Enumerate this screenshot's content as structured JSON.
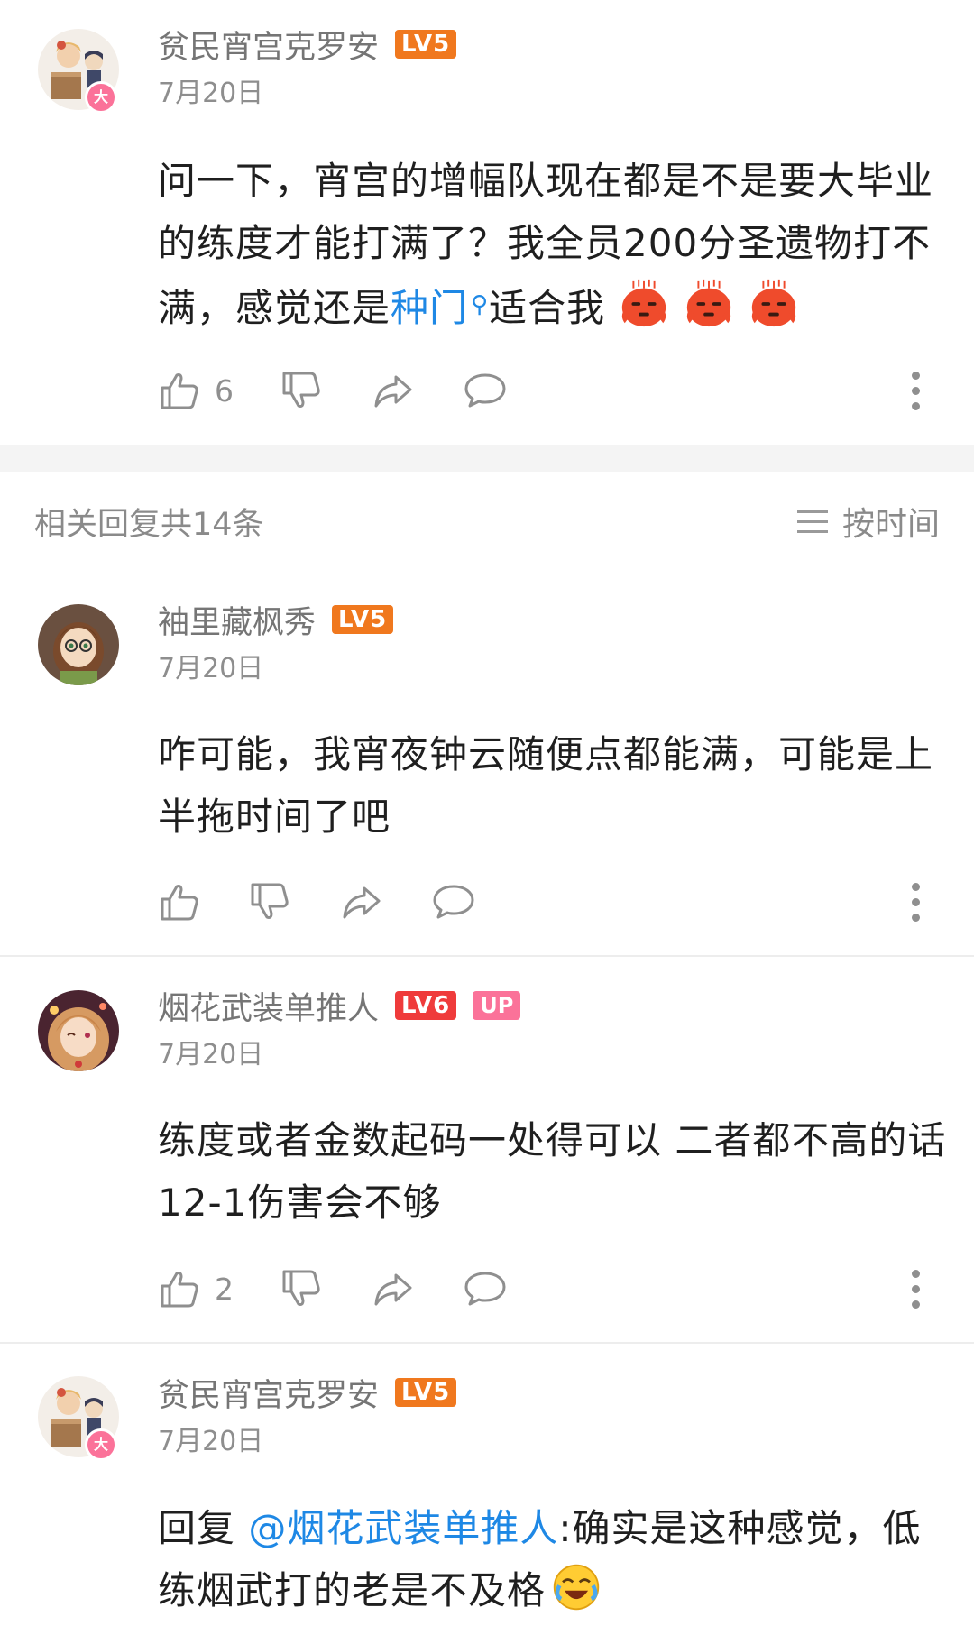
{
  "main_comment": {
    "username": "贫民宵宫克罗安",
    "level": "LV5",
    "avatar_badge": "大",
    "date": "7月20日",
    "text_before_link": "问一下，宵宫的增幅队现在都是不是要大毕业的练度才能打满了？我全员200分圣遗物打不满，感觉还是",
    "link_text": "种门",
    "text_after_link": "适合我",
    "emoji": "red-blob-emoji",
    "like_count": "6"
  },
  "replies_header": {
    "count_label": "相关回复共14条",
    "sort_label": "按时间"
  },
  "replies": [
    {
      "username": "袖里藏枫秀",
      "level": "LV5",
      "date": "7月20日",
      "text": "咋可能，我宵夜钟云随便点都能满，可能是上半拖时间了吧",
      "like_count": ""
    },
    {
      "username": "烟花武装单推人",
      "level": "LV6",
      "up_tag": "UP",
      "date": "7月20日",
      "text": "练度或者金数起码一处得可以 二者都不高的话12-1伤害会不够",
      "like_count": "2"
    },
    {
      "username": "贫民宵宫克罗安",
      "level": "LV5",
      "avatar_badge": "大",
      "date": "7月20日",
      "reply_prefix": "回复 ",
      "mention": "@烟花武装单推人",
      "text": ":确实是这种感觉，低练烟武打的老是不及格",
      "emoji": "laughing-crying-emoji"
    }
  ],
  "icons": {
    "like": "thumbs-up-icon",
    "dislike": "thumbs-down-icon",
    "share": "share-icon",
    "comment": "comment-icon",
    "more": "more-vertical-icon",
    "sort": "sort-lines-icon"
  },
  "colors": {
    "link": "#1e88e5",
    "lv5": "#f0781e",
    "lv6": "#ef3b3b",
    "up_tag": "#fb7299",
    "secondary_text": "#8e8e8e"
  }
}
